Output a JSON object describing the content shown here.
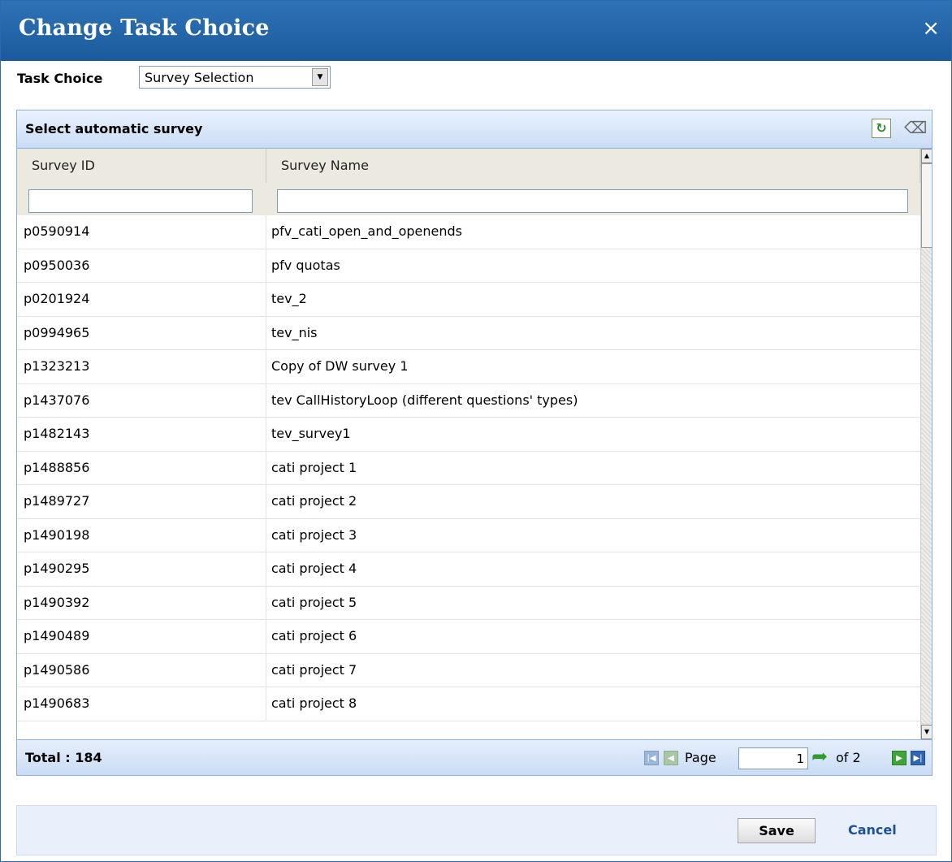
{
  "dialog": {
    "title": "Change Task Choice",
    "close_glyph": "×"
  },
  "task_choice": {
    "label": "Task Choice",
    "selected": "Survey Selection"
  },
  "grid": {
    "title": "Select automatic survey",
    "columns": [
      "Survey ID",
      "Survey Name"
    ],
    "filters": {
      "survey_id": "",
      "survey_name": ""
    },
    "rows": [
      {
        "id": "p0590914",
        "name": "pfv_cati_open_and_openends"
      },
      {
        "id": "p0950036",
        "name": "pfv quotas"
      },
      {
        "id": "p0201924",
        "name": "tev_2"
      },
      {
        "id": "p0994965",
        "name": "tev_nis"
      },
      {
        "id": "p1323213",
        "name": "Copy of DW survey 1"
      },
      {
        "id": "p1437076",
        "name": "tev CallHistoryLoop (different questions' types)"
      },
      {
        "id": "p1482143",
        "name": "tev_survey1"
      },
      {
        "id": "p1488856",
        "name": "cati project 1"
      },
      {
        "id": "p1489727",
        "name": "cati project 2"
      },
      {
        "id": "p1490198",
        "name": "cati project 3"
      },
      {
        "id": "p1490295",
        "name": "cati project 4"
      },
      {
        "id": "p1490392",
        "name": "cati project 5"
      },
      {
        "id": "p1490489",
        "name": "cati project 6"
      },
      {
        "id": "p1490586",
        "name": "cati project 7"
      },
      {
        "id": "p1490683",
        "name": "cati project 8"
      }
    ],
    "footer": {
      "total_label": "Total : 184",
      "page_label": "Page",
      "page_value": "1",
      "of_label": "of 2"
    }
  },
  "icons": {
    "refresh": "refresh-icon",
    "clear": "eraser-icon",
    "go": "go-arrow-icon",
    "first": "first-page-icon",
    "prev": "prev-page-icon",
    "next": "next-page-icon",
    "last": "last-page-icon"
  },
  "actions": {
    "save": "Save",
    "cancel": "Cancel"
  },
  "colors": {
    "title_bar": "#1b5a9c",
    "header_bg": "#c9dcf5",
    "cancel_link": "#1e4f9c",
    "next_btn": "#3fa43a"
  }
}
